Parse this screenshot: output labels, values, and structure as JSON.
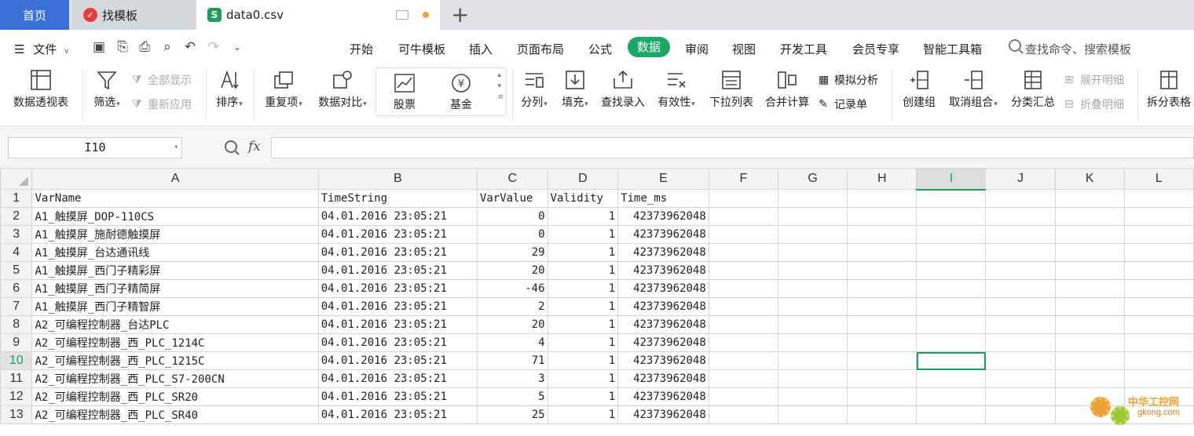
{
  "tabs": {
    "home": "首页",
    "template": "找模板",
    "file": "data0.csv"
  },
  "menu": [
    "开始",
    "可牛模板",
    "插入",
    "页面布局",
    "公式",
    "数据",
    "审阅",
    "视图",
    "开发工具",
    "会员专享",
    "智能工具箱"
  ],
  "file_menu": "文件",
  "search_placeholder": "查找命令、搜索模板",
  "ribbon": {
    "pivot": "数据透视表",
    "filter": "筛选",
    "show_all": "全部显示",
    "reapply": "重新应用",
    "sort": "排序",
    "dup": "重复项",
    "compare": "数据对比",
    "stock": "股票",
    "fund": "基金",
    "split": "分列",
    "fill": "填充",
    "lookup": "查找录入",
    "validity": "有效性",
    "dropdown": "下拉列表",
    "consolidate": "合并计算",
    "simulate": "模拟分析",
    "record": "记录单",
    "group": "创建组",
    "ungroup": "取消组合",
    "subtotal": "分类汇总",
    "expand": "展开明细",
    "collapse": "折叠明细",
    "split_table": "拆分表格"
  },
  "name_box": "I10",
  "fx": "fx",
  "columns": [
    "A",
    "B",
    "C",
    "D",
    "E",
    "F",
    "G",
    "H",
    "I",
    "J",
    "K",
    "L"
  ],
  "rows": [
    [
      "VarName",
      "TimeString",
      "VarValue",
      "Validity",
      "Time_ms"
    ],
    [
      "A1_触摸屏_DOP-110CS",
      "04.01.2016 23:05:21",
      "0",
      "1",
      "42373962048"
    ],
    [
      "A1_触摸屏_施耐德触摸屏",
      "04.01.2016 23:05:21",
      "0",
      "1",
      "42373962048"
    ],
    [
      "A1_触摸屏_台达通讯线",
      "04.01.2016 23:05:21",
      "29",
      "1",
      "42373962048"
    ],
    [
      "A1_触摸屏_西门子精彩屏",
      "04.01.2016 23:05:21",
      "20",
      "1",
      "42373962048"
    ],
    [
      "A1_触摸屏_西门子精简屏",
      "04.01.2016 23:05:21",
      "-46",
      "1",
      "42373962048"
    ],
    [
      "A1_触摸屏_西门子精智屏",
      "04.01.2016 23:05:21",
      "2",
      "1",
      "42373962048"
    ],
    [
      "A2_可编程控制器_台达PLC",
      "04.01.2016 23:05:21",
      "20",
      "1",
      "42373962048"
    ],
    [
      "A2_可编程控制器_西_PLC_1214C",
      "04.01.2016 23:05:21",
      "4",
      "1",
      "42373962048"
    ],
    [
      "A2_可编程控制器_西_PLC_1215C",
      "04.01.2016 23:05:21",
      "71",
      "1",
      "42373962048"
    ],
    [
      "A2_可编程控制器_西_PLC_S7-200CN",
      "04.01.2016 23:05:21",
      "3",
      "1",
      "42373962048"
    ],
    [
      "A2_可编程控制器_西_PLC_SR20",
      "04.01.2016 23:05:21",
      "5",
      "1",
      "42373962048"
    ],
    [
      "A2_可编程控制器_西_PLC_SR40",
      "04.01.2016 23:05:21",
      "25",
      "1",
      "42373962048"
    ]
  ],
  "watermark": {
    "cn": "中华工控网",
    "url": "gkong.com"
  }
}
